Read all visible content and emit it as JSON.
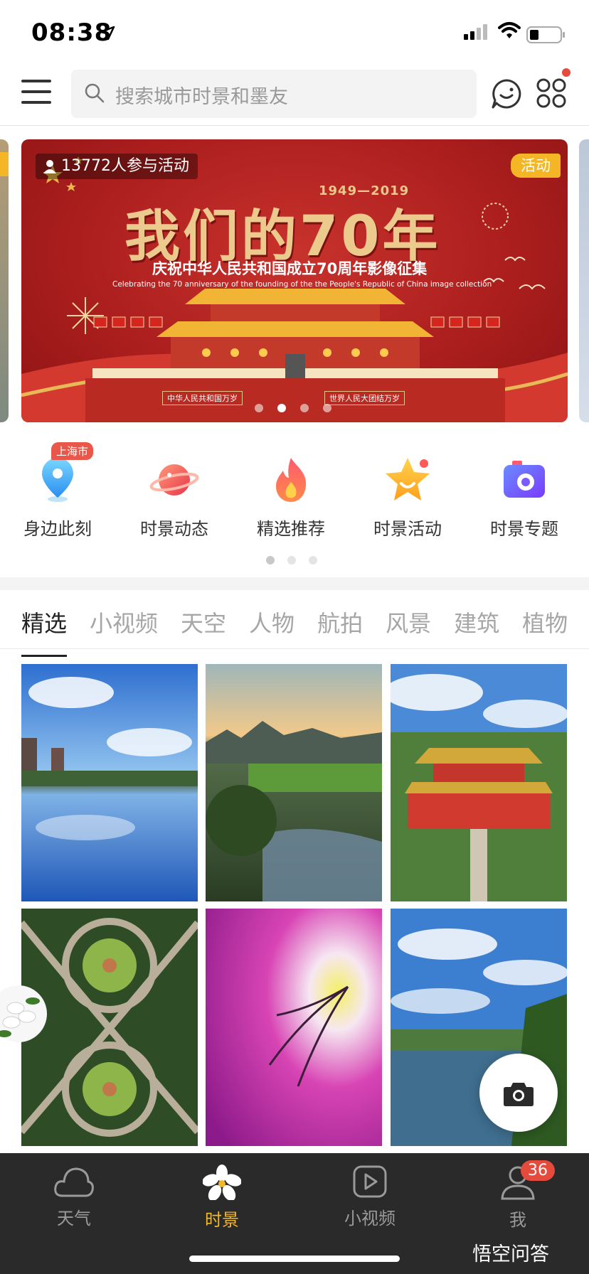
{
  "status_bar": {
    "time": "08:38"
  },
  "header": {
    "search_placeholder": "搜索城市时景和墨友"
  },
  "banner": {
    "participants": "13772人参与活动",
    "tag": "活动",
    "years": "1949—2019",
    "title": "我们的70年",
    "subtitle": "庆祝中华人民共和国成立70周年影像征集",
    "subtitle_en": "Celebrating the 70 anniversary of the founding of the the People's Republic of China image collection",
    "slogan_left": "中华人民共和国万岁",
    "slogan_right": "世界人民大团结万岁"
  },
  "quick_nav": {
    "city_badge": "上海市",
    "items": [
      {
        "label": "身边此刻",
        "icon": "location-pin-icon"
      },
      {
        "label": "时景动态",
        "icon": "planet-icon"
      },
      {
        "label": "精选推荐",
        "icon": "flame-icon"
      },
      {
        "label": "时景活动",
        "icon": "star-icon"
      },
      {
        "label": "时景专题",
        "icon": "camera-icon"
      }
    ]
  },
  "tabs": [
    "精选",
    "小视频",
    "天空",
    "人物",
    "航拍",
    "风景",
    "建筑",
    "植物"
  ],
  "photos": [
    {
      "subject": "lake-with-clouds"
    },
    {
      "subject": "sunset-river-valley"
    },
    {
      "subject": "chinese-palace-gate"
    },
    {
      "subject": "highway-interchange-aerial"
    },
    {
      "subject": "pink-flower-macro"
    },
    {
      "subject": "river-blue-sky"
    }
  ],
  "tabbar": {
    "items": [
      {
        "label": "天气",
        "icon": "cloud-icon"
      },
      {
        "label": "时景",
        "icon": "jasmine-flower-icon"
      },
      {
        "label": "小视频",
        "icon": "play-icon"
      },
      {
        "label": "我",
        "icon": "user-icon"
      }
    ],
    "badge": "36",
    "watermark": "悟空问答"
  },
  "colors": {
    "accent": "#f3b72b",
    "badge": "#e54b3c",
    "banner_red": "#a91d1d"
  }
}
